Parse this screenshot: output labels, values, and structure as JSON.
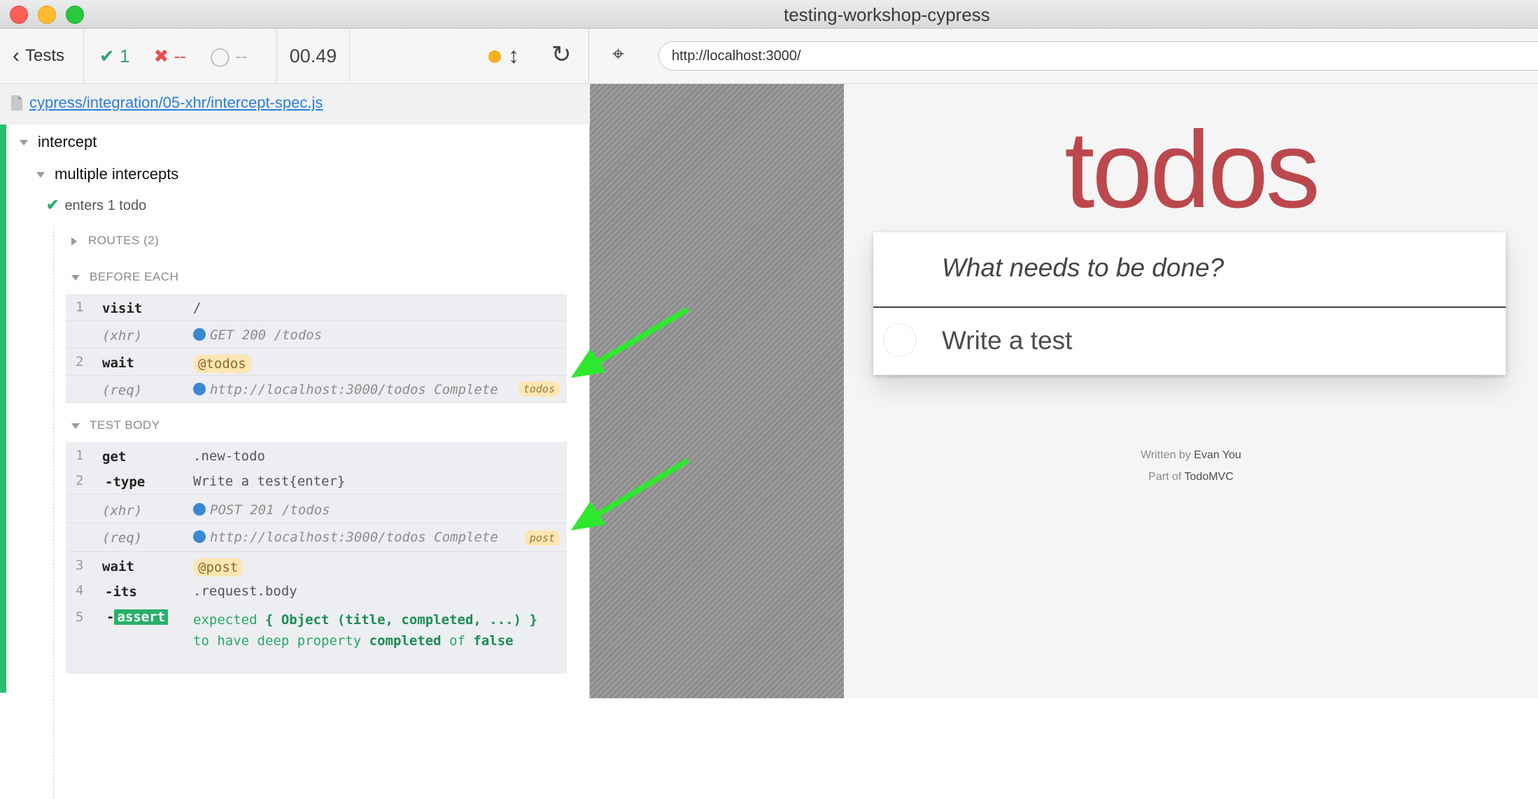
{
  "window": {
    "title": "testing-workshop-cypress"
  },
  "reporter": {
    "tests_label": "Tests",
    "passed": "1",
    "failed": "--",
    "pending": "--",
    "duration": "00.49",
    "file_path": "cypress/integration/05-xhr/intercept-spec.js",
    "suite": "intercept",
    "subsuite": "multiple intercepts",
    "test": "enters 1 todo",
    "routes_label": "ROUTES (2)",
    "before_each_label": "BEFORE EACH",
    "test_body_label": "TEST BODY",
    "before_each": [
      {
        "num": "1",
        "name": "visit",
        "msg": "/"
      },
      {
        "num": "",
        "name": "(xhr)",
        "msg": "GET 200 /todos"
      },
      {
        "num": "2",
        "name": "wait",
        "msg": "@todos"
      },
      {
        "num": "",
        "name": "(req)",
        "msg": "http://localhost:3000/todos Complete",
        "alias": "todos"
      }
    ],
    "test_body": [
      {
        "num": "1",
        "name": "get",
        "msg": ".new-todo"
      },
      {
        "num": "2",
        "name": "-type",
        "msg": "Write a test{enter}"
      },
      {
        "num": "",
        "name": "(xhr)",
        "msg": "POST 201 /todos"
      },
      {
        "num": "",
        "name": "(req)",
        "msg": "http://localhost:3000/todos Complete",
        "alias": "post"
      },
      {
        "num": "3",
        "name": "wait",
        "msg": "@post"
      },
      {
        "num": "4",
        "name": "-its",
        "msg": ".request.body"
      },
      {
        "num": "5",
        "name_prefix": "-",
        "name": "assert",
        "assert": {
          "expected": "expected",
          "subject": "{ Object (title, completed, ...) }",
          "mid": "to have deep property",
          "prop": "completed",
          "of": "of",
          "value": "false"
        }
      }
    ]
  },
  "aut": {
    "url": "http://localhost:3000/",
    "app_title": "todos",
    "new_todo_placeholder": "What needs to be done?",
    "todos": [
      {
        "title": "Write a test",
        "completed": false
      }
    ],
    "footer": {
      "written_by_prefix": "Written by",
      "author": "Evan You",
      "part_of_prefix": "Part of",
      "project": "TodoMVC"
    }
  },
  "colors": {
    "pass": "#28c06e",
    "fail": "#e94f4f",
    "alias_bg": "#fde6b3",
    "arrow": "#2ee82e",
    "todos_title": "#b83f45",
    "link": "#2b7ee1"
  }
}
